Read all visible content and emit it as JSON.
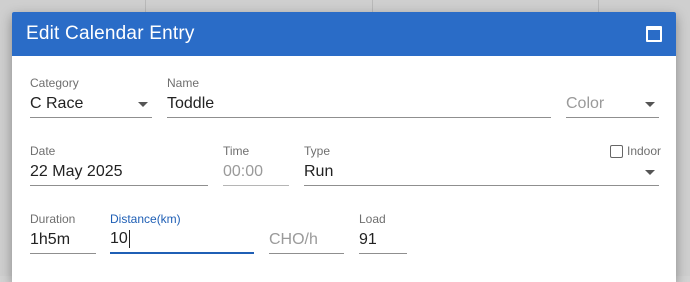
{
  "dialog": {
    "title": "Edit Calendar Entry",
    "maximize_icon": "maximize-icon"
  },
  "fields": {
    "category": {
      "label": "Category",
      "value": "C Race"
    },
    "name": {
      "label": "Name",
      "value": "Toddle"
    },
    "color": {
      "label": "",
      "placeholder": "Color"
    },
    "date": {
      "label": "Date",
      "value": "22 May 2025"
    },
    "time": {
      "label": "Time",
      "placeholder": "00:00"
    },
    "type": {
      "label": "Type",
      "value": "Run"
    },
    "indoor": {
      "label": "Indoor",
      "checked": false
    },
    "duration": {
      "label": "Duration",
      "value": "1h5m"
    },
    "distance": {
      "label": "Distance(km)",
      "value": "10"
    },
    "cho": {
      "label": "",
      "placeholder": "CHO/h"
    },
    "load": {
      "label": "Load",
      "value": "91"
    }
  },
  "colors": {
    "titlebar": "#2a6cc7",
    "focus": "#1f5fb5"
  }
}
